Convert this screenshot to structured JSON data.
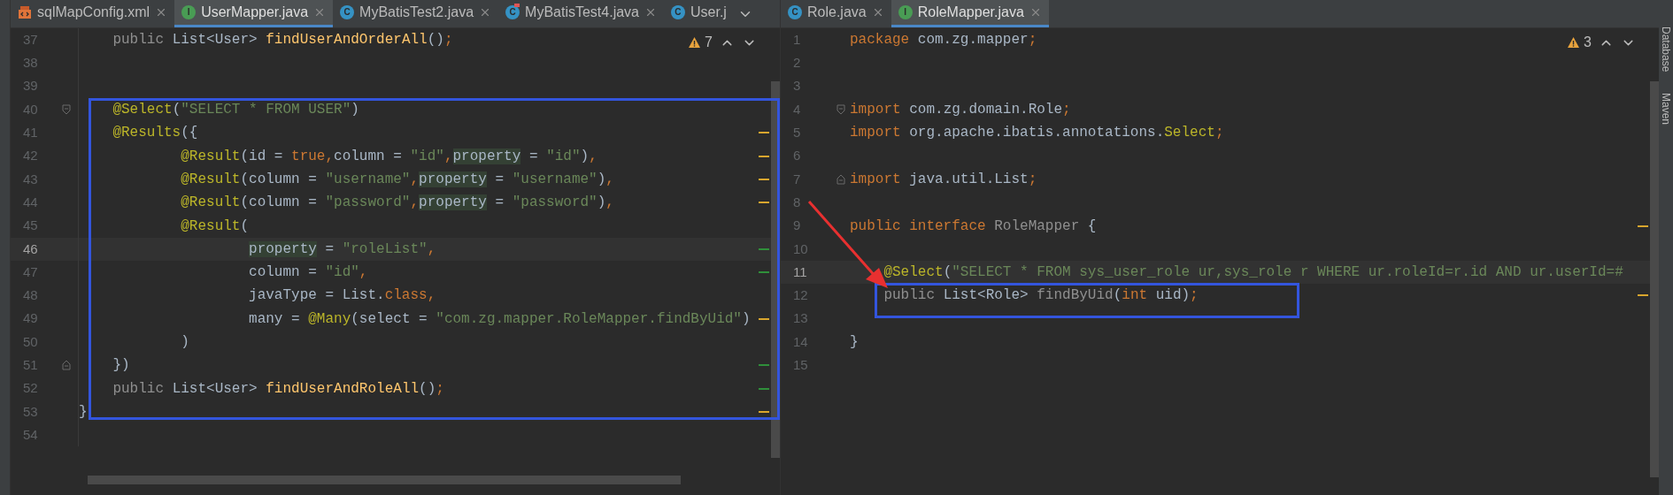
{
  "left_pane": {
    "tabs": [
      {
        "label": "sqlMapConfig.xml",
        "kind": "xml",
        "selected": false
      },
      {
        "label": "UserMapper.java",
        "kind": "interface",
        "badge": "I",
        "selected": true
      },
      {
        "label": "MyBatisTest2.java",
        "kind": "class",
        "badge": "C",
        "selected": false
      },
      {
        "label": "MyBatisTest4.java",
        "kind": "test",
        "badge": "C",
        "selected": false
      },
      {
        "label": "User.j",
        "kind": "class",
        "badge": "C",
        "selected": false,
        "cut": true
      }
    ],
    "warnings": "7",
    "lines": [
      {
        "number": "37",
        "current": false,
        "tokens": [
          {
            "t": "    public ",
            "kind": "dim"
          },
          {
            "t": "List<User> ",
            "kind": "plain"
          },
          {
            "t": "findUserAndOrderAll",
            "kind": "fn"
          },
          {
            "t": "()",
            "kind": "plain"
          },
          {
            "t": ";",
            "kind": "kw"
          }
        ]
      },
      {
        "number": "38",
        "current": false
      },
      {
        "number": "39",
        "current": false
      },
      {
        "number": "40",
        "current": false,
        "fold": {
          "kind": "start"
        },
        "tokens": [
          {
            "t": "    @Select",
            "kind": "ann"
          },
          {
            "t": "(",
            "kind": "plain"
          },
          {
            "t": "\"SELECT * FROM USER\"",
            "kind": "str"
          },
          {
            "t": ")",
            "kind": "plain"
          }
        ]
      },
      {
        "number": "41",
        "current": false,
        "marker": {
          "kind": "warning"
        },
        "tokens": [
          {
            "t": "    @Results",
            "kind": "ann"
          },
          {
            "t": "({",
            "kind": "plain"
          }
        ]
      },
      {
        "number": "42",
        "current": false,
        "marker": {
          "kind": "warning"
        },
        "tokens": [
          {
            "t": "            @Result",
            "kind": "ann"
          },
          {
            "t": "(id = ",
            "kind": "plain"
          },
          {
            "t": "true,",
            "kind": "kw"
          },
          {
            "t": "column = ",
            "kind": "plain"
          },
          {
            "t": "\"id\"",
            "kind": "str"
          },
          {
            "t": ",",
            "kind": "kw"
          },
          {
            "t": "property",
            "kind": "hl"
          },
          {
            "t": " = ",
            "kind": "plain"
          },
          {
            "t": "\"id\"",
            "kind": "str"
          },
          {
            "t": ")",
            "kind": "plain"
          },
          {
            "t": ",",
            "kind": "kw"
          }
        ]
      },
      {
        "number": "43",
        "current": false,
        "marker": {
          "kind": "warning"
        },
        "tokens": [
          {
            "t": "            @Result",
            "kind": "ann"
          },
          {
            "t": "(column = ",
            "kind": "plain"
          },
          {
            "t": "\"username\"",
            "kind": "str"
          },
          {
            "t": ",",
            "kind": "kw"
          },
          {
            "t": "property",
            "kind": "hl"
          },
          {
            "t": " = ",
            "kind": "plain"
          },
          {
            "t": "\"username\"",
            "kind": "str"
          },
          {
            "t": ")",
            "kind": "plain"
          },
          {
            "t": ",",
            "kind": "kw"
          }
        ]
      },
      {
        "number": "44",
        "current": false,
        "marker": {
          "kind": "warning"
        },
        "tokens": [
          {
            "t": "            @Result",
            "kind": "ann"
          },
          {
            "t": "(column = ",
            "kind": "plain"
          },
          {
            "t": "\"password\"",
            "kind": "str"
          },
          {
            "t": ",",
            "kind": "kw"
          },
          {
            "t": "property",
            "kind": "hl"
          },
          {
            "t": " = ",
            "kind": "plain"
          },
          {
            "t": "\"password\"",
            "kind": "str"
          },
          {
            "t": ")",
            "kind": "plain"
          },
          {
            "t": ",",
            "kind": "kw"
          }
        ]
      },
      {
        "number": "45",
        "current": false,
        "tokens": [
          {
            "t": "            @Result",
            "kind": "ann"
          },
          {
            "t": "(",
            "kind": "plain"
          }
        ]
      },
      {
        "number": "46",
        "current": true,
        "marker": {
          "kind": "change"
        },
        "tokens": [
          {
            "t": "                    property",
            "kind": "hl"
          },
          {
            "t": " = ",
            "kind": "plain"
          },
          {
            "t": "\"roleList\"",
            "kind": "str"
          },
          {
            "t": ",",
            "kind": "kw"
          }
        ]
      },
      {
        "number": "47",
        "current": false,
        "marker": {
          "kind": "change"
        },
        "tokens": [
          {
            "t": "                    column = ",
            "kind": "plain"
          },
          {
            "t": "\"id\"",
            "kind": "str"
          },
          {
            "t": ",",
            "kind": "kw"
          }
        ]
      },
      {
        "number": "48",
        "current": false,
        "tokens": [
          {
            "t": "                    javaType = List.",
            "kind": "plain"
          },
          {
            "t": "class,",
            "kind": "kw"
          }
        ]
      },
      {
        "number": "49",
        "current": false,
        "marker": {
          "kind": "warning"
        },
        "tokens": [
          {
            "t": "                    many = ",
            "kind": "plain"
          },
          {
            "t": "@Many",
            "kind": "ann"
          },
          {
            "t": "(select = ",
            "kind": "plain"
          },
          {
            "t": "\"com.zg.mapper.RoleMapper.findByUid\"",
            "kind": "str"
          },
          {
            "t": ")",
            "kind": "plain"
          }
        ]
      },
      {
        "number": "50",
        "current": false,
        "tokens": [
          {
            "t": "            )",
            "kind": "plain"
          }
        ]
      },
      {
        "number": "51",
        "current": false,
        "fold": {
          "kind": "end"
        },
        "marker": {
          "kind": "change"
        },
        "tokens": [
          {
            "t": "    })",
            "kind": "plain"
          }
        ]
      },
      {
        "number": "52",
        "current": false,
        "marker": {
          "kind": "change"
        },
        "tokens": [
          {
            "t": "    public ",
            "kind": "dim"
          },
          {
            "t": "List<User> ",
            "kind": "plain"
          },
          {
            "t": "findUserAndRoleAll",
            "kind": "fn"
          },
          {
            "t": "()",
            "kind": "plain"
          },
          {
            "t": ";",
            "kind": "kw"
          }
        ]
      },
      {
        "number": "53",
        "current": false,
        "marker": {
          "kind": "warning"
        },
        "tokens": [
          {
            "t": "}",
            "kind": "plain"
          }
        ]
      },
      {
        "number": "54",
        "current": false
      }
    ]
  },
  "right_pane": {
    "tabs": [
      {
        "label": "Role.java",
        "kind": "class",
        "badge": "C",
        "selected": false
      },
      {
        "label": "RoleMapper.java",
        "kind": "interface",
        "badge": "I",
        "selected": true
      }
    ],
    "warnings": "3",
    "lines": [
      {
        "number": "1",
        "current": false,
        "tokens": [
          {
            "t": "package ",
            "kind": "kw"
          },
          {
            "t": "com.zg.mapper",
            "kind": "plain"
          },
          {
            "t": ";",
            "kind": "kw"
          }
        ]
      },
      {
        "number": "2",
        "current": false
      },
      {
        "number": "3",
        "current": false
      },
      {
        "number": "4",
        "current": false,
        "fold": {
          "kind": "start"
        },
        "tokens": [
          {
            "t": "import ",
            "kind": "kw"
          },
          {
            "t": "com.zg.domain.Role",
            "kind": "plain"
          },
          {
            "t": ";",
            "kind": "kw"
          }
        ]
      },
      {
        "number": "5",
        "current": false,
        "tokens": [
          {
            "t": "import ",
            "kind": "kw"
          },
          {
            "t": "org.apache.ibatis.annotations.",
            "kind": "plain"
          },
          {
            "t": "Select",
            "kind": "ann"
          },
          {
            "t": ";",
            "kind": "kw"
          }
        ]
      },
      {
        "number": "6",
        "current": false
      },
      {
        "number": "7",
        "current": false,
        "fold": {
          "kind": "end"
        },
        "tokens": [
          {
            "t": "import ",
            "kind": "kw"
          },
          {
            "t": "java.util.List",
            "kind": "plain"
          },
          {
            "t": ";",
            "kind": "kw"
          }
        ]
      },
      {
        "number": "8",
        "current": false
      },
      {
        "number": "9",
        "current": false,
        "marker": {
          "kind": "warning"
        },
        "tokens": [
          {
            "t": "public interface ",
            "kind": "kw"
          },
          {
            "t": "RoleMapper ",
            "kind": "dim"
          },
          {
            "t": "{",
            "kind": "plain"
          }
        ]
      },
      {
        "number": "10",
        "current": false
      },
      {
        "number": "11",
        "current": true,
        "tokens": [
          {
            "t": "    @Select",
            "kind": "ann"
          },
          {
            "t": "(",
            "kind": "plain"
          },
          {
            "t": "\"SELECT * FROM sys_user_role ur,sys_role r WHERE ur.roleId=r.id AND ur.userId=#",
            "kind": "str"
          }
        ]
      },
      {
        "number": "12",
        "current": false,
        "marker": {
          "kind": "warning"
        },
        "tokens": [
          {
            "t": "    public ",
            "kind": "dim"
          },
          {
            "t": "List<Role> ",
            "kind": "plain"
          },
          {
            "t": "findByUid",
            "kind": "dim"
          },
          {
            "t": "(",
            "kind": "plain"
          },
          {
            "t": "int ",
            "kind": "kw"
          },
          {
            "t": "uid)",
            "kind": "plain"
          },
          {
            "t": ";",
            "kind": "kw"
          }
        ]
      },
      {
        "number": "13",
        "current": false
      },
      {
        "number": "14",
        "current": false,
        "tokens": [
          {
            "t": "}",
            "kind": "plain"
          }
        ]
      },
      {
        "number": "15",
        "current": false
      }
    ]
  },
  "tool_windows": [
    "Database",
    "Maven"
  ]
}
